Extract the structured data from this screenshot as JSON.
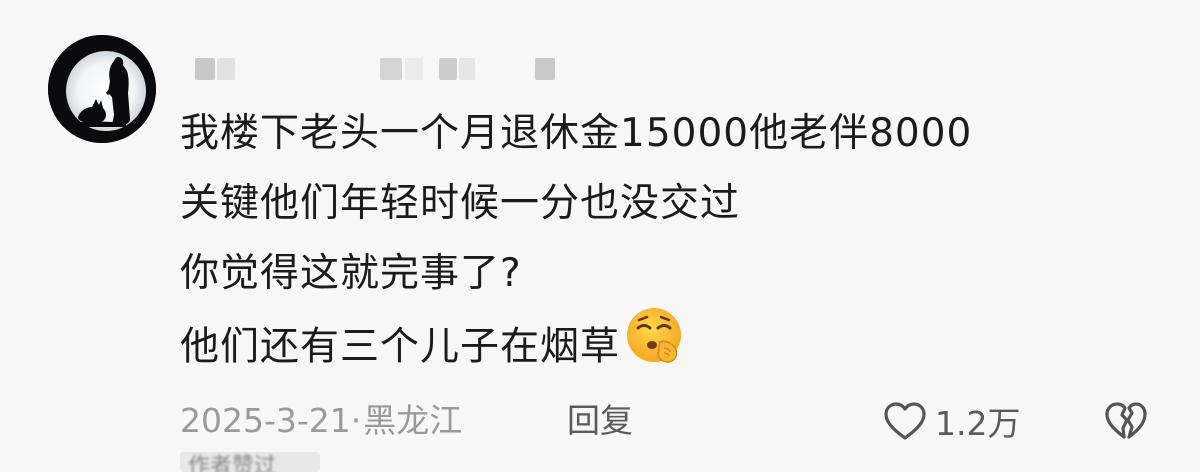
{
  "comment": {
    "username_hidden": true,
    "lines": [
      "我楼下老头一个月退休金15000他老伴8000",
      "关键他们年轻时候一分也没交过",
      "你觉得这就完事了?",
      "他们还有三个儿子在烟草"
    ],
    "emoji": "shushing-face-emoji",
    "date": "2025-3-21",
    "separator": "·",
    "location": "黑龙江",
    "reply_label": "回复",
    "like_count": "1.2万",
    "bottom_tag": "作者赞过"
  },
  "icons": {
    "like": "heart-outline-icon",
    "dislike": "broken-heart-icon"
  },
  "colors": {
    "background": "#f7f7f7",
    "text": "#1b1b1b",
    "meta": "#9a9a9a",
    "action": "#5a5a5a"
  }
}
